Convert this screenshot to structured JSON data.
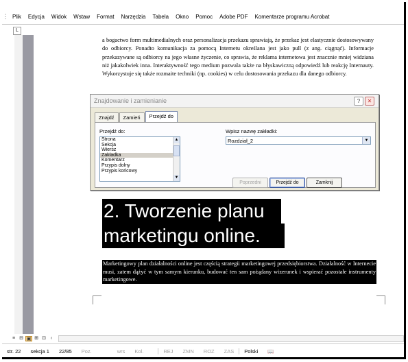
{
  "menu": {
    "items": [
      "Plik",
      "Edycja",
      "Widok",
      "Wstaw",
      "Format",
      "Narzędzia",
      "Tabela",
      "Okno",
      "Pomoc",
      "Adobe PDF",
      "Komentarze programu Acrobat"
    ]
  },
  "ruler": {
    "tab_marker": "L"
  },
  "document": {
    "paragraph1": "a bogactwo form multimedialnych oraz personalizacja przekazu sprawiają, że przekaz jest elastycznie dostosowywany do odbiorcy. Ponadto komunikacja za pomocą Internetu określana jest jako pull (z ang. ciągnąć). Informacje przekazywane są odbiorcy na jego własne życzenie, co sprawia, że reklama internetowa jest znacznie mniej widziana niż jakakolwiek inna. Interaktywność tego medium pozwala także na błyskawiczną odpowiedź lub reakcję Internauty. Wykorzystuje się także rozmaite techniki (np. cookies) w celu dostosowania przekazu dla danego odbiorcy.",
    "heading_line1": "2. Tworzenie planu",
    "heading_line2": "marketingu online.",
    "paragraph2": "Marketingowy plan działalności online jest częścią strategii marketingowej przedsiębiorstwa. Działalność w Internecie musi, zatem dążyć w tym samym kierunku, budować ten sam pożądany wizerunek i wspierać pozostałe instrumenty marketingowe."
  },
  "dialog": {
    "title": "Znajdowanie i zamienianie",
    "help_glyph": "?",
    "close_glyph": "✕",
    "tabs": [
      "Znajdź",
      "Zamień",
      "Przejdź do"
    ],
    "active_tab": "Przejdź do",
    "goto_label": "Przejdź do:",
    "goto_options": [
      "Strona",
      "Sekcja",
      "Wiersz",
      "Zakładka",
      "Komentarz",
      "Przypis dolny",
      "Przypis końcowy"
    ],
    "selected_option": "Zakładka",
    "bookmark_label": "Wpisz nazwę zakładki:",
    "bookmark_value": "Rozdział_2",
    "buttons": {
      "previous": "Poprzedni",
      "goto": "Przejdź do",
      "close": "Zamknij"
    }
  },
  "viewbar": {
    "buttons": [
      "≡",
      "⊟",
      "▣",
      "⊞",
      "⊡",
      "‹"
    ]
  },
  "status": {
    "page": "str. 22",
    "section": "sekcja 1",
    "pages": "22/85",
    "poz": "Poz.",
    "wrs": "wrs",
    "kol": "Kol.",
    "rej": "REJ",
    "zmn": "ZMN",
    "roz": "ROZ",
    "zas": "ZAS",
    "language": "Polski",
    "spell_icon": "spellcheck-book-icon"
  },
  "colors": {
    "dialog_bg": "#ece9d8",
    "selection_bg": "#000000",
    "left_margin": "#9a9aa3"
  }
}
